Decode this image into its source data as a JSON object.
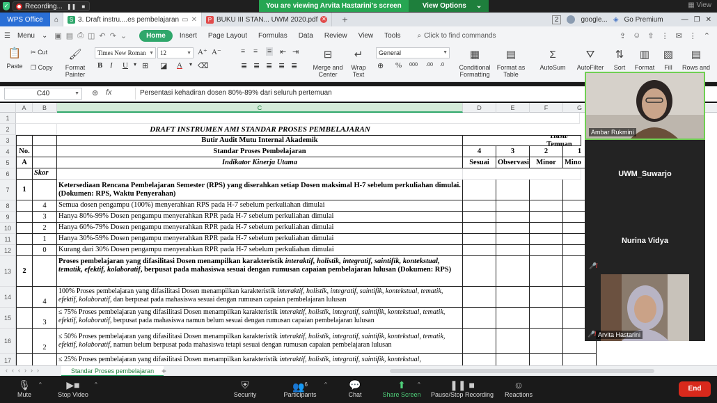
{
  "zoom_top": {
    "recording": "Recording...",
    "banner": "You are viewing Arvita Hastarini's screen",
    "view_options": "View Options",
    "view": "View"
  },
  "wps_tabs": {
    "logo": "WPS Office",
    "tab1": "3. Draft instru....es pembelajaran",
    "tab2": "BUKU III STAN... UWM 2020.pdf",
    "badge": "2",
    "account": "google...",
    "premium": "Go Premium"
  },
  "menu": {
    "menu": "Menu",
    "items": [
      "Home",
      "Insert",
      "Page Layout",
      "Formulas",
      "Data",
      "Review",
      "View",
      "Tools"
    ],
    "search": "Click to find commands"
  },
  "ribbon": {
    "paste": "Paste",
    "cut": "Cut",
    "copy": "Copy",
    "format_painter": "Format Painter",
    "font": "Times New Roman",
    "size": "12",
    "merge": "Merge and Center",
    "wrap": "Wrap Text",
    "number_format": "General",
    "conditional": "Conditional Formatting",
    "format_table": "Format as Table",
    "autosum": "AutoSum",
    "autofilter": "AutoFilter",
    "sort": "Sort",
    "format": "Format",
    "fill": "Fill",
    "rows_cols": "Rows and"
  },
  "formula_bar": {
    "cell": "C40",
    "fx": "fx",
    "content": "Persentasi kehadiran dosen 80%-89% dari seluruh pertemuan"
  },
  "grid": {
    "columns": [
      "A",
      "B",
      "C",
      "D",
      "E",
      "F",
      "G"
    ],
    "rows": [
      "1",
      "2",
      "3",
      "4",
      "5",
      "6",
      "7",
      "8",
      "9",
      "10",
      "11",
      "12",
      "13",
      "14",
      "15",
      "16",
      "17"
    ],
    "title": "DRAFT INSTRUMEN AMI STANDAR PROSES PEMBELAJARAN",
    "h3": "Butir Audit Mutu Internal Akademik",
    "h3_result": "Hasil/ Temuan",
    "h4_no": "No.",
    "h4": "Standar Proses Pembelajaran",
    "h4_scores": [
      "4",
      "3",
      "2",
      "1"
    ],
    "h5_a": "A",
    "h5": "Indikator Kinerja Utama",
    "h5_labels": [
      "Sesuai",
      "Observasi",
      "Minor",
      "Mino"
    ],
    "h6_skor": "Skor",
    "s1_no": "1",
    "s1_text": "Ketersediaan Rencana Pembelajaran Semester (RPS) yang diserahkan setiap Dosen maksimal H-7 sebelum perkuliahan dimulai. (Dokumen: RPS, Waktu Penyerahan)",
    "s1_items": [
      {
        "skor": "4",
        "text": "Semua dosen pengampu (100%) menyerahkan RPS pada H-7 sebelum perkuliahan dimulai"
      },
      {
        "skor": "3",
        "text": "Hanya 80%-99%  Dosen pengampu menyerahkan RPR pada H-7 sebelum perkuliahan dimulai"
      },
      {
        "skor": "2",
        "text": "Hanya 60%-79%  Dosen pengampu menyerahkan RPR pada H-7 sebelum perkuliahan dimulai"
      },
      {
        "skor": "1",
        "text": "Hanya 30%-59%  Dosen pengampu menyerahkan RPR pada H-7 sebelum perkuliahan dimulai"
      },
      {
        "skor": "0",
        "text": "Kurang dari 30%  Dosen pengampu menyerahkan RPR pada H-7 sebelum perkuliahan dimulai"
      }
    ],
    "s2_no": "2",
    "s2_pre": "Proses pembelajaran yang difasilitasi Dosen menampilkan karakteristik ",
    "s2_italic": "interaktif, holistik, integratif, saintifik, kontekstual, tematik, efektif, kolaboratif",
    "s2_post": ", berpusat pada mahasiswa  sesuai dengan rumusan capaian pembelajaran lulusan (Dokumen: RPS)",
    "s2_items": [
      {
        "skor": "4",
        "pre": "100% Proses pembelajaran yang difasilitasi Dosen menampilkan karakteristik ",
        "it": "interaktif, holistik, integratif, saintifik, kontekstual, tematik, efektif, kolaboratif,",
        "post": "  dan berpusat pada mahasiswa sesuai dengan rumusan capaian pembelajaran lulusan"
      },
      {
        "skor": "3",
        "pre": "≤ 75% Proses pembelajaran yang difasilitasi Dosen menampilkan karakteristik ",
        "it": "interaktif, holistik, integratif, saintifik, kontekstual, tematik, efektif, kolaboratif",
        "post": ", berpusat pada mahasiswa namun belum sesuai dengan rumusan capaian pembelajaran lulusan"
      },
      {
        "skor": "2",
        "pre": "≤ 50% Proses pembelajaran yang difasilitasi Dosen menampilkan karakteristik ",
        "it": "interaktif, holistik, integratif, saintifik, kontekstual, tematik, efektif, kolaboratif,",
        "post": "  namun belum berpusat pada mahasiswa tetapi sesuai dengan rumusan capaian pembelajaran lulusan"
      },
      {
        "skor": "",
        "pre": "≤ 25% Proses pembelajaran yang difasilitasi Dosen menampilkan karakteristik ",
        "it": "interaktif, holistik, integratif, saintifik, kontekstual,",
        "post": ""
      }
    ]
  },
  "sheet": {
    "name": "Standar Proses pembelajaran"
  },
  "participants": [
    {
      "name": "Ambar Rukmini",
      "type": "video"
    },
    {
      "name": "UWM_Suwarjo",
      "type": "name"
    },
    {
      "name": "Nurina Vidya",
      "type": "name"
    },
    {
      "name": "Arvita Hastarini",
      "type": "video"
    }
  ],
  "zoom_bottom": {
    "mute": "Mute",
    "video": "Stop Video",
    "security": "Security",
    "participants": "Participants",
    "participants_count": "6",
    "chat": "Chat",
    "share": "Share Screen",
    "record": "Pause/Stop Recording",
    "reactions": "Reactions",
    "end": "End"
  },
  "colors": {
    "green": "#2fa76b",
    "end_red": "#d9291c",
    "banner": "#26a652"
  }
}
